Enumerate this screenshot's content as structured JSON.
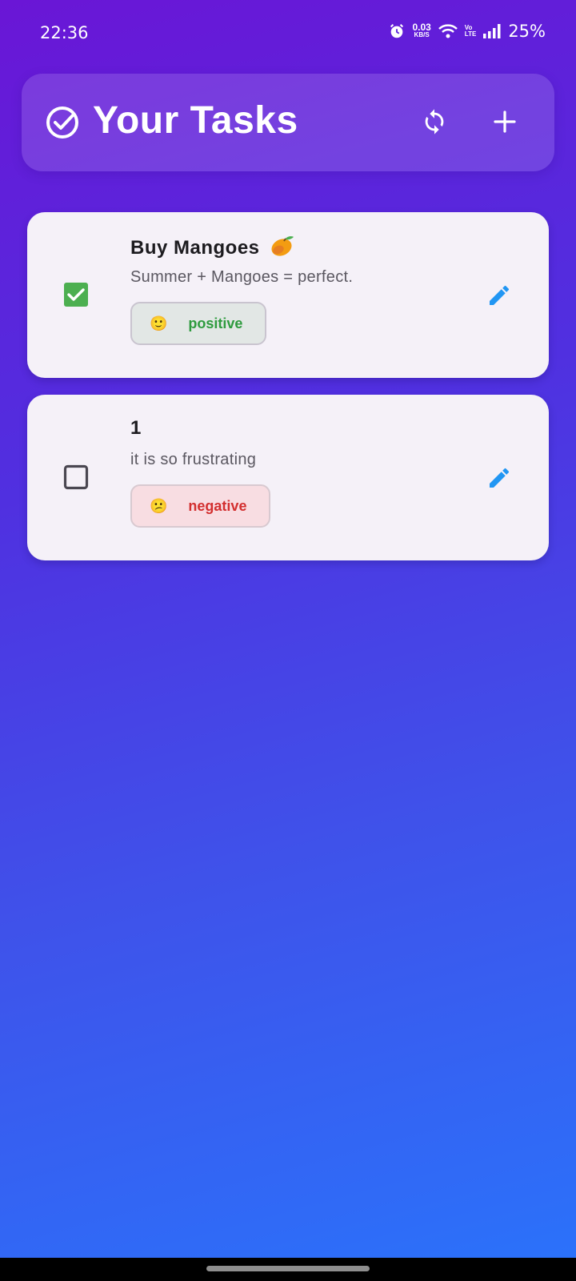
{
  "status_bar": {
    "time": "22:36",
    "net_speed_value": "0.03",
    "net_speed_unit": "KB/S",
    "volte_top": "Vo",
    "volte_bottom": "LTE",
    "battery": "25%",
    "icons": [
      "alarm-icon",
      "wifi-icon",
      "signal-icon"
    ]
  },
  "header": {
    "title": "Your Tasks",
    "icons": [
      "check-circle-icon",
      "refresh-icon",
      "plus-icon"
    ]
  },
  "tasks": [
    {
      "title": "Buy Mangoes",
      "title_emoji": "mango-icon",
      "description": "Summer + Mangoes = perfect.",
      "done": true,
      "sentiment_label": "positive",
      "sentiment_emoji": "🙂",
      "sentiment_color": "#2e9b3e"
    },
    {
      "title": "1",
      "description": "it is so frustrating",
      "done": false,
      "sentiment_label": "negative",
      "sentiment_emoji": "😕",
      "sentiment_color": "#d32f2f"
    }
  ],
  "colors": {
    "gradient_top": "#6a16d6",
    "gradient_bottom": "#2a73fb",
    "checkbox_checked": "#4caf50",
    "edit_icon": "#2196f3"
  }
}
